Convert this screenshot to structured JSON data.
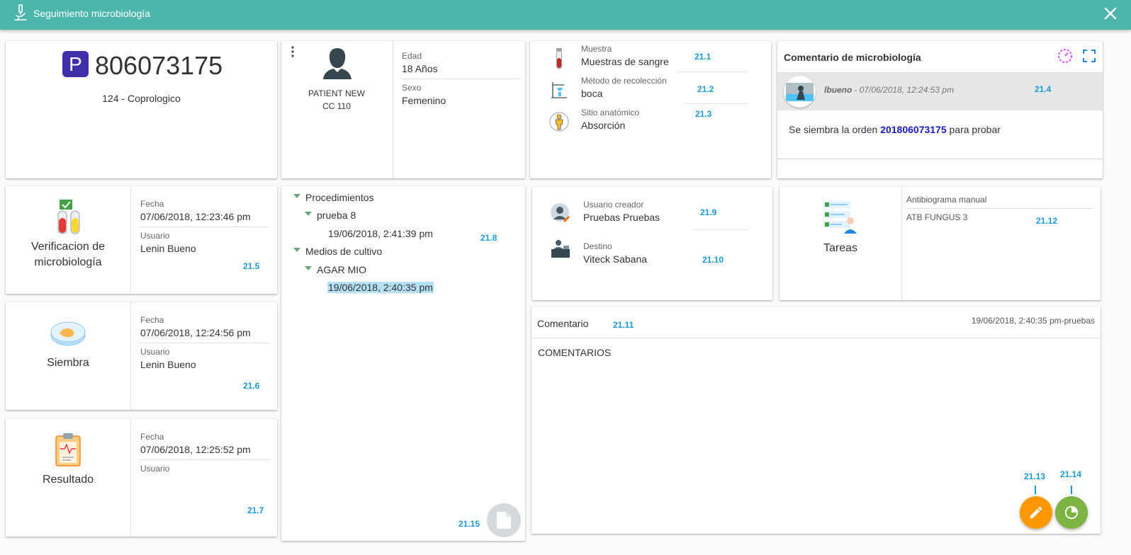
{
  "window": {
    "title": "Seguimiento microbiología",
    "close_icon": "close-icon"
  },
  "order": {
    "badge": "P",
    "number": "806073175",
    "test": "124 - Coprologico"
  },
  "patient": {
    "name": "PATIENT NEW",
    "document": "CC 110",
    "age_label": "Edad",
    "age_value": "18 Años",
    "sex_label": "Sexo",
    "sex_value": "Femenino"
  },
  "sample": {
    "muestra_label": "Muestra",
    "muestra_value": "Muestras de sangre",
    "muestra_ref": "21.1",
    "metodo_label": "Método de recolección",
    "metodo_value": "boca",
    "metodo_ref": "21.2",
    "sitio_label": "Sitio anatómico",
    "sitio_value": "Absorción",
    "sitio_ref": "21.3"
  },
  "comment_panel": {
    "title": "Comentario de microbiología",
    "author": "lbueno",
    "datetime": " - 07/06/2018, 12:24:53 pm",
    "ref": "21.4",
    "text_before": "Se siembra la orden ",
    "order_link": "201806073175",
    "text_after": " para probar"
  },
  "steps": {
    "verificacion": {
      "title_line1": "Verificacion de",
      "title_line2": "microbiología",
      "fecha_label": "Fecha",
      "fecha_value": "07/06/2018, 12:23:46 pm",
      "usuario_label": "Usuario",
      "usuario_value": "Lenin Bueno",
      "ref": "21.5"
    },
    "siembra": {
      "title": "Siembra",
      "fecha_label": "Fecha",
      "fecha_value": "07/06/2018, 12:24:56 pm",
      "usuario_label": "Usuario",
      "usuario_value": "Lenin Bueno",
      "ref": "21.6"
    },
    "resultado": {
      "title": "Resultado",
      "fecha_label": "Fecha",
      "fecha_value": "07/06/2018, 12:25:52 pm",
      "usuario_label": "Usuario",
      "usuario_value": "",
      "ref": "21.7"
    }
  },
  "tree": {
    "ref": "21.8",
    "procedimientos": "Procedimientos",
    "prueba": "prueba 8",
    "prueba_date": "19/06/2018, 2:41:39 pm",
    "medios": "Medios de cultivo",
    "agar": "AGAR MIO",
    "agar_date": "19/06/2018, 2:40:35 pm",
    "doc_ref": "21.15"
  },
  "users": {
    "creador_label": "Usuario creador",
    "creador_value": "Pruebas Pruebas",
    "creador_ref": "21.9",
    "destino_label": "Destino",
    "destino_value": "Viteck Sabana",
    "destino_ref": "21.10"
  },
  "tareas": {
    "title": "Tareas",
    "list_header": "Antibiograma manual",
    "item": "ATB FUNGUS 3",
    "ref": "21.12"
  },
  "comentario": {
    "title": "Comentario",
    "ref": "21.11",
    "meta": "19/06/2018, 2:40:35 pm-pruebas",
    "body": "COMENTARIOS",
    "edit_ref": "21.13",
    "chart_ref": "21.14"
  },
  "colors": {
    "header": "#4db6ac",
    "accent_ref": "#1a9ad6",
    "badge": "#3f2fa8",
    "fab_edit": "#ff9800",
    "fab_chart": "#7cb342"
  }
}
